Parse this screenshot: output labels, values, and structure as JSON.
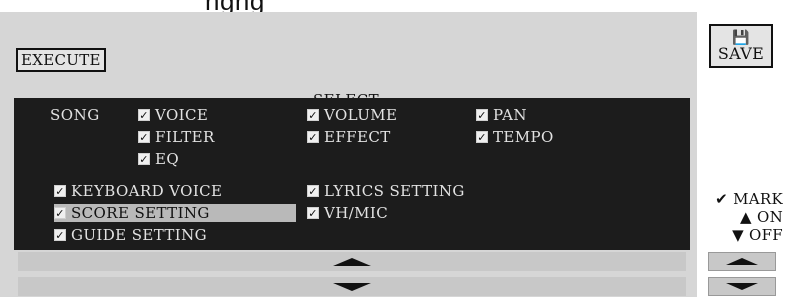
{
  "header_partial_text": "...ngng...",
  "execute_label": "EXECUTE",
  "select_label": "SELECT",
  "song_label": "SONG",
  "song_items": [
    {
      "label": "VOICE",
      "checked": true
    },
    {
      "label": "VOLUME",
      "checked": true
    },
    {
      "label": "PAN",
      "checked": true
    },
    {
      "label": "FILTER",
      "checked": true
    },
    {
      "label": "EFFECT",
      "checked": true
    },
    {
      "label": "TEMPO",
      "checked": true
    },
    {
      "label": "EQ",
      "checked": true
    }
  ],
  "other_items": [
    {
      "label": "KEYBOARD VOICE",
      "checked": true
    },
    {
      "label": "LYRICS SETTING",
      "checked": true
    },
    {
      "label": "SCORE SETTING",
      "checked": true,
      "selected": true
    },
    {
      "label": "VH/MIC",
      "checked": true
    },
    {
      "label": "GUIDE SETTING",
      "checked": true
    }
  ],
  "save_label": "SAVE",
  "legend": {
    "mark": "MARK",
    "on": "ON",
    "off": "OFF"
  },
  "icons": {
    "checkmark": "checkmark-icon",
    "disk": "floppy-disk-icon",
    "up": "triangle-up-icon",
    "down": "triangle-down-icon"
  }
}
